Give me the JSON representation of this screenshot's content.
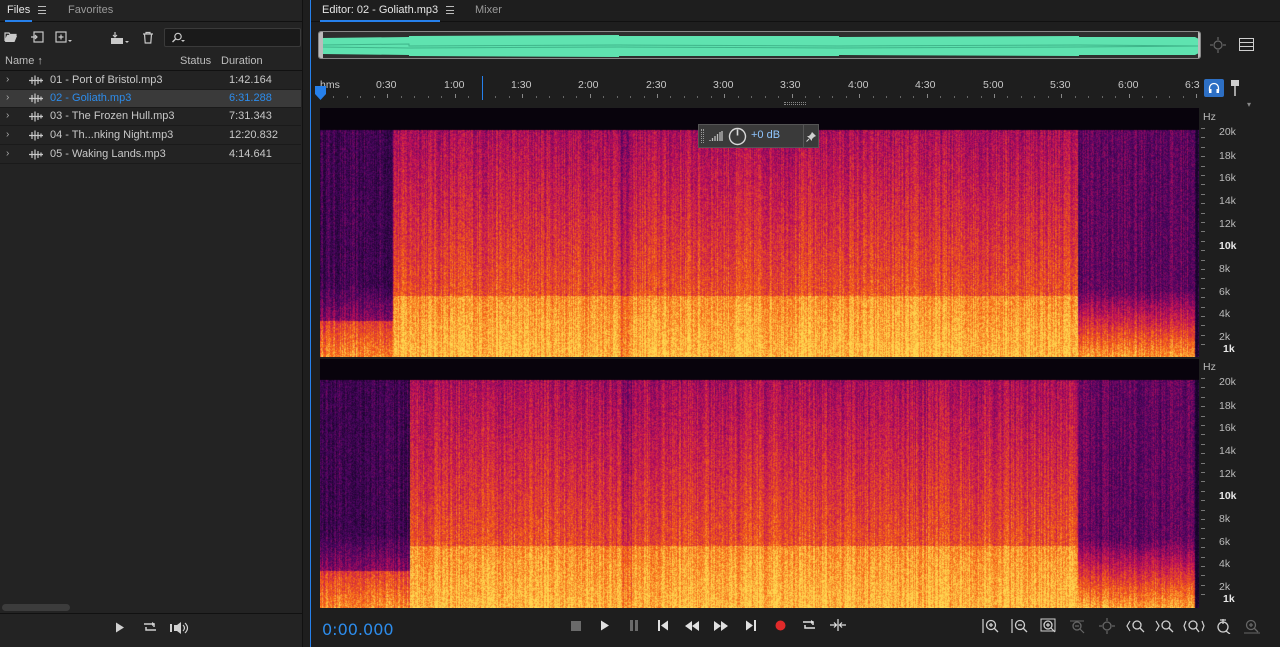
{
  "files_panel": {
    "tabs": [
      {
        "label": "Files"
      },
      {
        "label": "Favorites"
      }
    ],
    "search": {
      "placeholder": ""
    },
    "columns": {
      "name": "Name",
      "status": "Status",
      "duration": "Duration"
    },
    "files": [
      {
        "name": "01 - Port of Bristol.mp3",
        "duration": "1:42.164",
        "selected": false
      },
      {
        "name": "02 - Goliath.mp3",
        "duration": "6:31.288",
        "selected": true
      },
      {
        "name": "03 - The Frozen Hull.mp3",
        "duration": "7:31.343",
        "selected": false
      },
      {
        "name": "04 - Th...nking Night.mp3",
        "duration": "12:20.832",
        "selected": false
      },
      {
        "name": "05 - Waking Lands.mp3",
        "duration": "4:14.641",
        "selected": false
      }
    ]
  },
  "editor": {
    "tabs": [
      {
        "label": "Editor: 02 - Goliath.mp3"
      },
      {
        "label": "Mixer"
      }
    ],
    "ruler": {
      "unit_label": "hms",
      "ticks": [
        "0:30",
        "1:00",
        "1:30",
        "2:00",
        "2:30",
        "3:00",
        "3:30",
        "4:00",
        "4:30",
        "5:00",
        "5:30",
        "6:00",
        "6:3"
      ]
    },
    "freq_axis": {
      "unit": "Hz",
      "labels": [
        "20k",
        "18k",
        "16k",
        "14k",
        "12k",
        "10k",
        "8k",
        "6k",
        "4k",
        "2k",
        "1k"
      ]
    },
    "hud": {
      "gain": "+0 dB"
    },
    "time_display": "0:00.000"
  },
  "colors": {
    "accent": "#2680eb",
    "time_text": "#2d8ceb",
    "record": "#e02a2a",
    "overview_wave": "#5fe3b0"
  }
}
